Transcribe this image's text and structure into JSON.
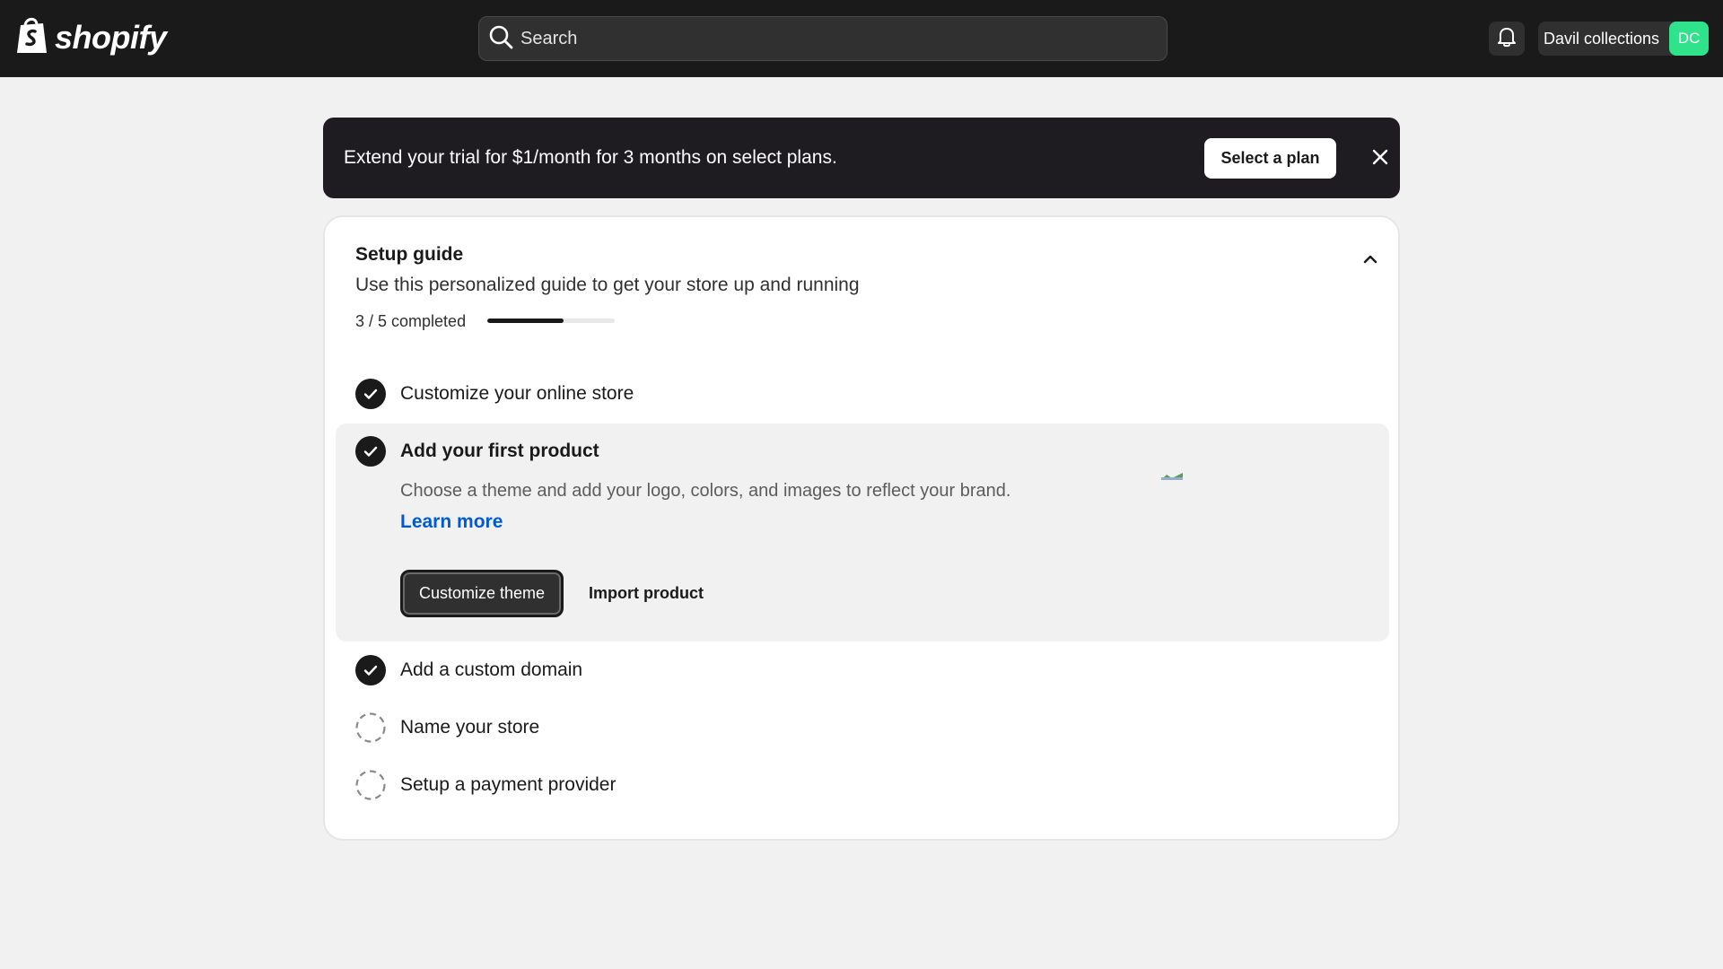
{
  "app": {
    "logo_text": "shopify"
  },
  "search": {
    "placeholder": "Search"
  },
  "account": {
    "store_name": "Davil collections",
    "initials": "DC"
  },
  "banner": {
    "text": "Extend your trial for $1/month for 3 months on select plans.",
    "button_label": "Select a plan"
  },
  "setup_guide": {
    "title": "Setup guide",
    "subtitle": "Use this personalized guide to get your store up and running",
    "progress_text": "3 / 5 completed",
    "progress_fraction": 0.6,
    "tasks": [
      {
        "label": "Customize your online store",
        "completed": true
      },
      {
        "label": "Add your first product",
        "completed": true,
        "expanded": true
      },
      {
        "label": "Add a custom domain",
        "completed": true
      },
      {
        "label": "Name your store",
        "completed": false
      },
      {
        "label": "Setup a payment provider",
        "completed": false
      }
    ],
    "expanded_task": {
      "description": "Choose a theme and add your logo, colors, and images to reflect your brand.",
      "learn_more": "Learn more",
      "primary_button": "Customize theme",
      "secondary_button": "Import product"
    }
  },
  "colors": {
    "topbar": "#1a1a1a",
    "banner": "#1f1c21",
    "avatar": "#2fe38a",
    "link": "#005bd3",
    "page_bg": "#f1f1f1"
  },
  "icons": {
    "logo": "shopify-bag-icon",
    "search": "search-icon",
    "bell": "bell-icon",
    "close": "close-icon",
    "collapse": "chevron-up-icon",
    "complete": "check-circle-icon",
    "incomplete": "dashed-circle-icon"
  }
}
